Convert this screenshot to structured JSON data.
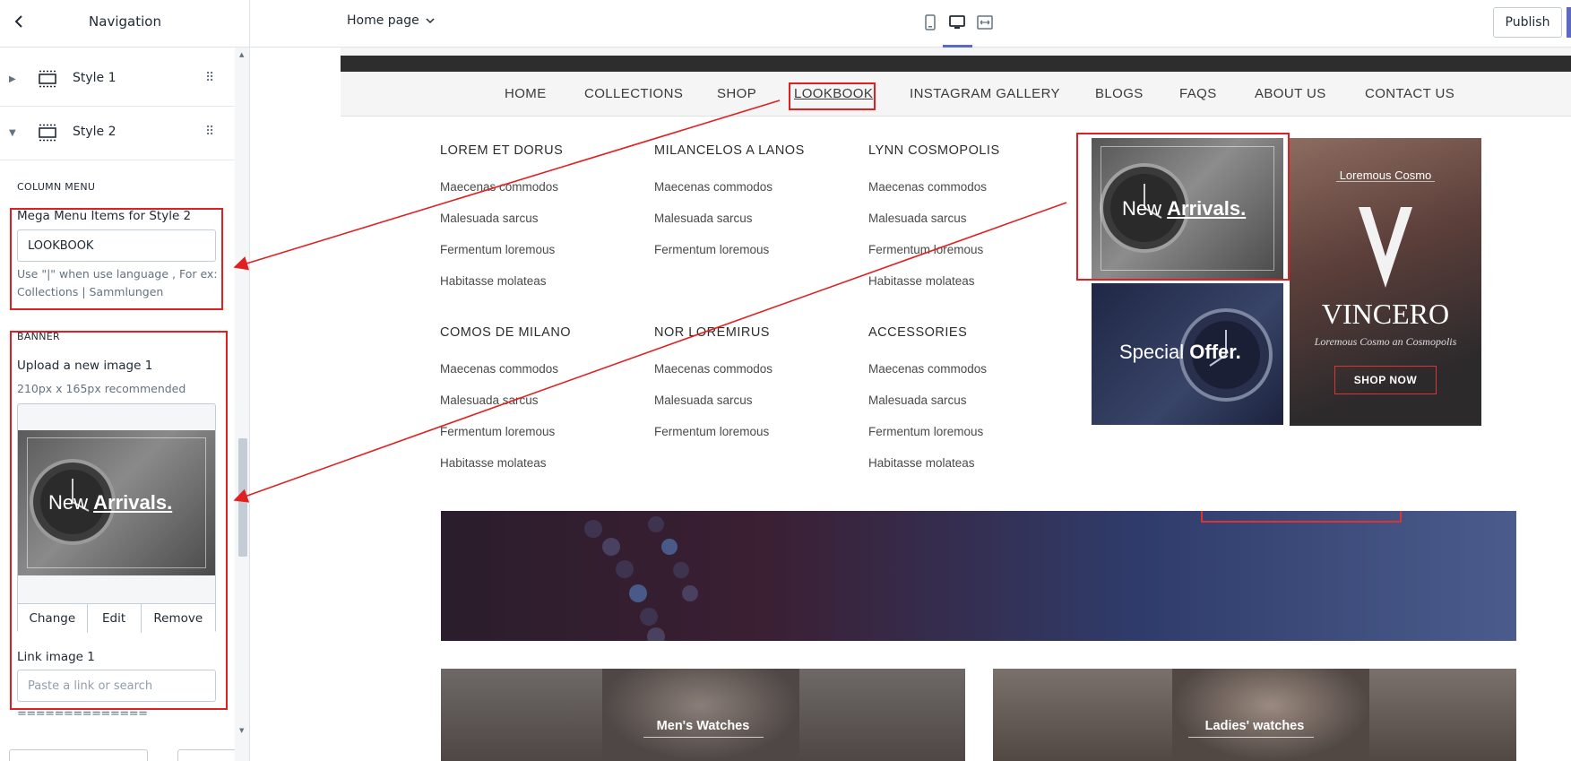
{
  "sidebar": {
    "title": "Navigation",
    "rows": [
      {
        "label": "Style 1",
        "expanded": false
      },
      {
        "label": "Style 2",
        "expanded": true
      }
    ],
    "column_menu_heading": "COLUMN MENU",
    "mega_label": "Mega Menu Items for Style 2",
    "mega_value": "LOOKBOOK",
    "mega_help_1": "Use \"|\" when use language , For ex:",
    "mega_help_2": "Collections | Sammlungen",
    "banner_heading": "BANNER",
    "upload_label": "Upload a new image 1",
    "upload_hint": "210px x 165px recommended",
    "preview_text_1": "New",
    "preview_text_2": "Arrivals.",
    "btn_change": "Change",
    "btn_edit": "Edit",
    "btn_remove": "Remove",
    "link_label": "Link image 1",
    "link_placeholder": "Paste a link or search",
    "divider_text": "=============="
  },
  "topbar": {
    "page_select": "Home page",
    "publish_label": "Publish",
    "devices": [
      "mobile-icon",
      "desktop-icon",
      "fullwidth-icon"
    ]
  },
  "preview": {
    "nav": [
      "HOME",
      "COLLECTIONS",
      "SHOP",
      "LOOKBOOK",
      "INSTAGRAM GALLERY",
      "BLOGS",
      "FAQS",
      "ABOUT US",
      "CONTACT US"
    ],
    "columns": [
      {
        "title": "LOREM ET DORUS",
        "items": [
          "Maecenas commodos",
          "Malesuada sarcus",
          "Fermentum loremous",
          "Habitasse molateas"
        ]
      },
      {
        "title": "MILANCELOS A LANOS",
        "items": [
          "Maecenas commodos",
          "Malesuada sarcus",
          "Fermentum loremous"
        ]
      },
      {
        "title": "LYNN COSMOPOLIS",
        "items": [
          "Maecenas commodos",
          "Malesuada sarcus",
          "Fermentum loremous",
          "Habitasse molateas"
        ]
      },
      {
        "title": "COMOS DE MILANO",
        "items": [
          "Maecenas commodos",
          "Malesuada sarcus",
          "Fermentum loremous",
          "Habitasse molateas"
        ]
      },
      {
        "title": "NOR LOREMIRUS",
        "items": [
          "Maecenas commodos",
          "Malesuada sarcus",
          "Fermentum loremous"
        ]
      },
      {
        "title": "ACCESSORIES",
        "items": [
          "Maecenas commodos",
          "Malesuada sarcus",
          "Fermentum loremous",
          "Habitasse molateas"
        ]
      }
    ],
    "banner1_a": "New",
    "banner1_b": "Arrivals.",
    "banner2_a": "Special",
    "banner2_b": "Offer.",
    "banner3_top": "Loremous Cosmo",
    "banner3_brand": "VINCERO",
    "banner3_sub": "Loremous Cosmo an Cosmopolis",
    "banner3_btn": "SHOP NOW",
    "tile1": "Men's Watches",
    "tile2": "Ladies' watches"
  },
  "colors": {
    "accent": "#5c6ac4",
    "annotation": "#e02020"
  }
}
